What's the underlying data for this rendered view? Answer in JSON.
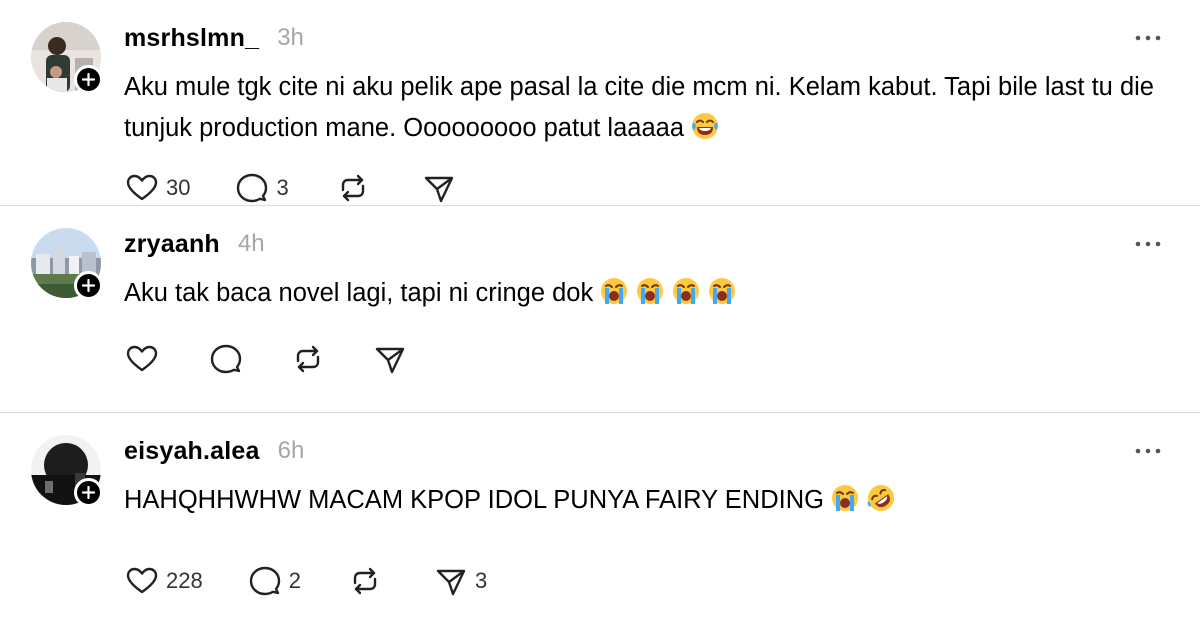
{
  "posts": [
    {
      "username": "msrhslmn_",
      "time": "3h",
      "text": "Aku mule tgk cite ni aku pelik ape pasal la cite die mcm ni. Kelam kabut. Tapi bile last tu die tunjuk production mane. Ooooooooo patut laaaaa",
      "emojis": [
        "tears-of-joy"
      ],
      "likes": "30",
      "replies": "3",
      "reposts": "",
      "shares": ""
    },
    {
      "username": "zryaanh",
      "time": "4h",
      "text": "Aku tak baca novel lagi, tapi ni cringe dok",
      "emojis": [
        "loudly-crying",
        "loudly-crying",
        "loudly-crying",
        "loudly-crying"
      ],
      "likes": "",
      "replies": "",
      "reposts": "",
      "shares": ""
    },
    {
      "username": "eisyah.alea",
      "time": "6h",
      "text": "HAHQHHWHW MACAM KPOP IDOL PUNYA FAIRY ENDING",
      "emojis": [
        "loudly-crying",
        "rolling-on-floor-laughing"
      ],
      "likes": "228",
      "replies": "2",
      "reposts": "",
      "shares": "3"
    }
  ],
  "icons": {
    "like": "heart-icon",
    "reply": "comment-icon",
    "repost": "repost-icon",
    "share": "send-icon",
    "more": "more-icon",
    "follow": "plus-icon"
  },
  "colors": {
    "text": "#000000",
    "muted": "#a6a6a6",
    "divider": "#dcdcdc"
  }
}
